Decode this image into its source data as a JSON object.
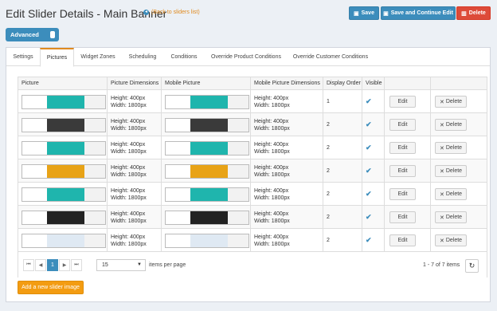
{
  "header": {
    "title": "Edit Slider Details - Main Banner",
    "back_link": "(Back to sliders list)",
    "save_label": "Save",
    "save_continue_label": "Save and Continue Edit",
    "delete_label": "Delete"
  },
  "advanced_toggle": {
    "label": "Advanced"
  },
  "tabs": [
    "Settings",
    "Pictures",
    "Widget Zones",
    "Scheduling",
    "Conditions",
    "Override Product Conditions",
    "Override Customer Conditions"
  ],
  "active_tab": "Pictures",
  "grid": {
    "columns": [
      "Picture",
      "Picture Dimensions",
      "Mobile Picture",
      "Mobile Picture Dimensions",
      "Display Order",
      "Visible",
      "",
      ""
    ],
    "rows": [
      {
        "height": "Height: 400px",
        "width": "Width: 1800px",
        "m_height": "Height: 400px",
        "m_width": "Width: 1800px",
        "order": "1",
        "edit": "Edit",
        "delete": "Delete"
      },
      {
        "height": "Height: 400px",
        "width": "Width: 1800px",
        "m_height": "Height: 400px",
        "m_width": "Width: 1800px",
        "order": "2",
        "edit": "Edit",
        "delete": "Delete"
      },
      {
        "height": "Height: 400px",
        "width": "Width: 1800px",
        "m_height": "Height: 400px",
        "m_width": "Width: 1800px",
        "order": "2",
        "edit": "Edit",
        "delete": "Delete"
      },
      {
        "height": "Height: 400px",
        "width": "Width: 1800px",
        "m_height": "Height: 400px",
        "m_width": "Width: 1800px",
        "order": "2",
        "edit": "Edit",
        "delete": "Delete"
      },
      {
        "height": "Height: 400px",
        "width": "Width: 1800px",
        "m_height": "Height: 400px",
        "m_width": "Width: 1800px",
        "order": "2",
        "edit": "Edit",
        "delete": "Delete"
      },
      {
        "height": "Height: 400px",
        "width": "Width: 1800px",
        "m_height": "Height: 400px",
        "m_width": "Width: 1800px",
        "order": "2",
        "edit": "Edit",
        "delete": "Delete"
      },
      {
        "height": "Height: 400px",
        "width": "Width: 1800px",
        "m_height": "Height: 400px",
        "m_width": "Width: 1800px",
        "order": "2",
        "edit": "Edit",
        "delete": "Delete"
      }
    ],
    "banner_colors": [
      "#1fb5ad",
      "#3a3a3a",
      "#1fb5ad",
      "#e8a317",
      "#1fb5ad",
      "#222222",
      "#dfe9f3"
    ]
  },
  "pager": {
    "current_page": "1",
    "page_size": "15",
    "items_per_page_label": "items per page",
    "count_text": "1 - 7 of 7 items"
  },
  "add_button_label": "Add a new slider image",
  "colors": {
    "primary": "#3c8dbc",
    "danger": "#dd4b39",
    "accent": "#f39c12"
  }
}
